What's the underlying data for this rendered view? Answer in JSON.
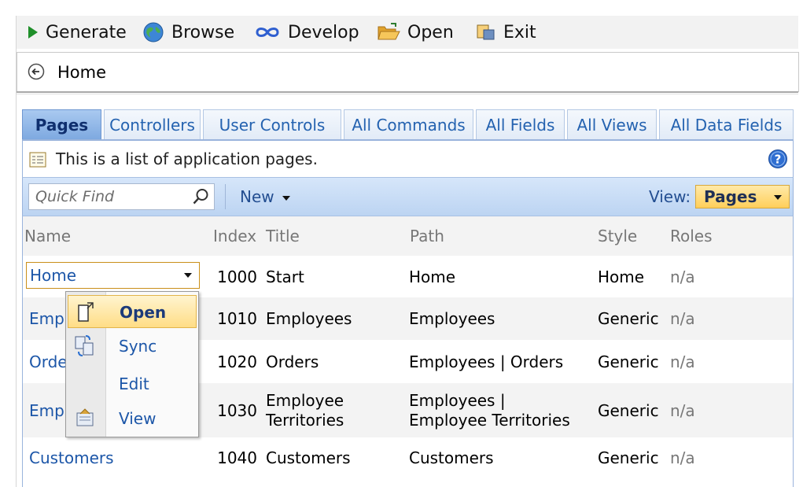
{
  "toolbar": {
    "generate": "Generate",
    "browse": "Browse",
    "develop": "Develop",
    "open": "Open",
    "exit": "Exit"
  },
  "breadcrumb": {
    "home": "Home"
  },
  "tabs": [
    {
      "label": "Pages",
      "active": true
    },
    {
      "label": "Controllers"
    },
    {
      "label": "User Controls"
    },
    {
      "label": "All Commands"
    },
    {
      "label": "All Fields"
    },
    {
      "label": "All Views"
    },
    {
      "label": "All Data Fields"
    }
  ],
  "description": "This is a list of application pages.",
  "actionbar": {
    "quick_find_placeholder": "Quick Find",
    "new_label": "New",
    "view_label": "View:",
    "view_value": "Pages"
  },
  "grid": {
    "columns": [
      "Name",
      "Index",
      "Title",
      "Path",
      "Style",
      "Roles"
    ],
    "rows": [
      {
        "name": "Home",
        "index": "1000",
        "title": "Start",
        "path": "Home",
        "style": "Home",
        "roles": "n/a"
      },
      {
        "name": "Empl",
        "index": "1010",
        "title": "Employees",
        "path": "Employees",
        "style": "Generic",
        "roles": "n/a"
      },
      {
        "name": "Orde",
        "index": "1020",
        "title": "Orders",
        "path": "Employees | Orders",
        "style": "Generic",
        "roles": "n/a"
      },
      {
        "name": "Empl",
        "index": "1030",
        "title": "Employee Territories",
        "path": "Employees | Employee Territories",
        "style": "Generic",
        "roles": "n/a"
      },
      {
        "name": "Customers",
        "index": "1040",
        "title": "Customers",
        "path": "Customers",
        "style": "Generic",
        "roles": "n/a"
      }
    ]
  },
  "context_menu": {
    "items": [
      "Open",
      "Sync",
      "Edit",
      "View"
    ],
    "selected": "Open"
  },
  "colors": {
    "link": "#1c56a8",
    "active_tab": "#7ea9e0",
    "view_select": "#ffcf5a",
    "menu_highlight": "#ffdd86"
  }
}
